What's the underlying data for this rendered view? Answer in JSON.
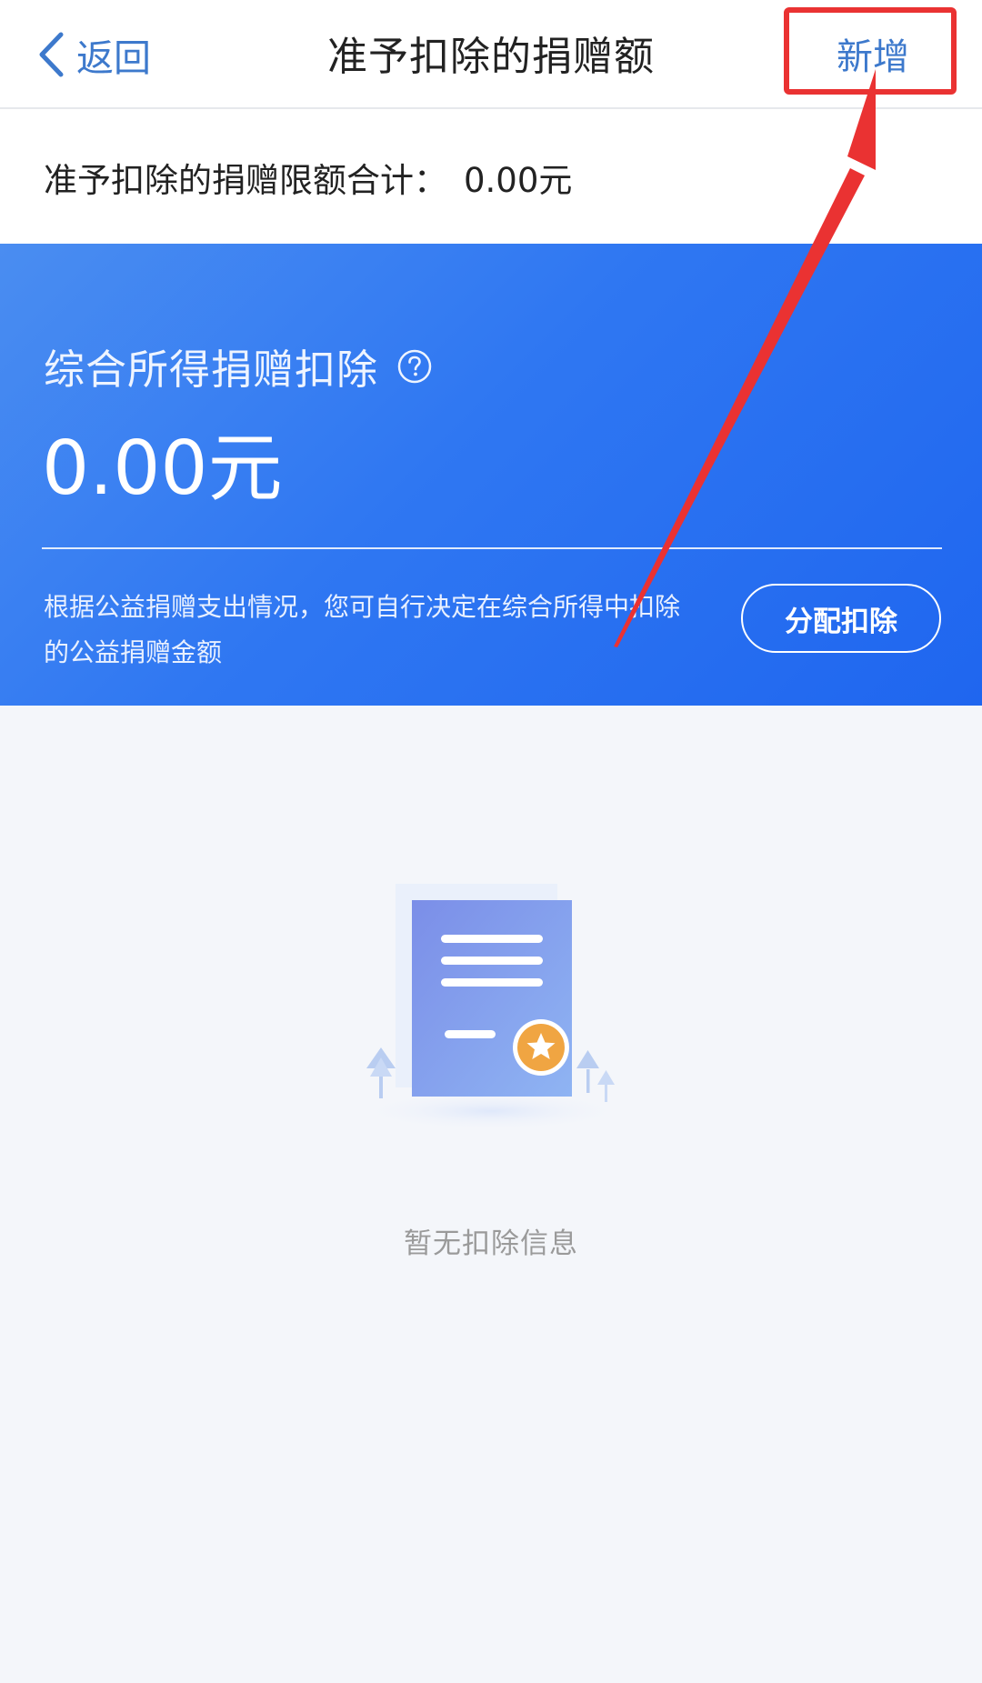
{
  "nav": {
    "back_label": "返回",
    "title": "准予扣除的捐赠额",
    "add_label": "新增"
  },
  "limit": {
    "label": "准予扣除的捐赠限额合计：",
    "value": "0.00元"
  },
  "banner": {
    "title": "综合所得捐赠扣除",
    "amount": "0.00元",
    "description": "根据公益捐赠支出情况，您可自行决定在综合所得中扣除的公益捐赠金额",
    "allocate_label": "分配扣除"
  },
  "empty_state": {
    "text": "暂无扣除信息"
  },
  "icons": {
    "back": "chevron-left-icon",
    "help": "question-circle-icon",
    "empty": "document-star-illustration"
  },
  "colors": {
    "link": "#3d79cc",
    "banner_start": "#4a8df1",
    "banner_end": "#1f66ef",
    "annotation": "#ea3232",
    "page_bg": "#f4f6fa"
  }
}
